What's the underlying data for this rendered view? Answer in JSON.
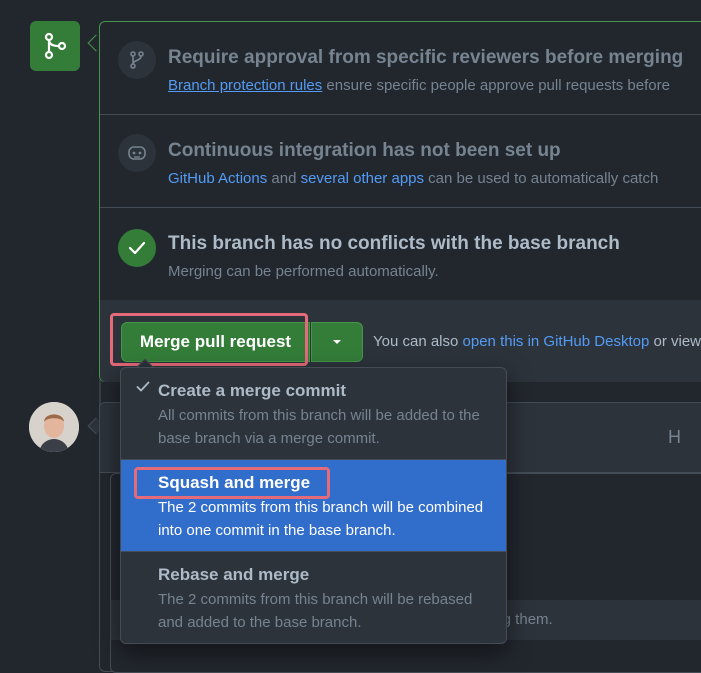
{
  "merge_box": {
    "reviewers": {
      "title": "Require approval from specific reviewers before merging",
      "link": "Branch protection rules",
      "rest": " ensure specific people approve pull requests before"
    },
    "ci": {
      "title": "Continuous integration has not been set up",
      "link1": "GitHub Actions",
      "mid": " and ",
      "link2": "several other apps",
      "rest": " can be used to automatically catch"
    },
    "conflicts": {
      "title": "This branch has no conflicts with the base branch",
      "desc": "Merging can be performed automatically."
    },
    "actions": {
      "merge_button": "Merge pull request",
      "also_prefix": "You can also ",
      "desktop_link": "open this in GitHub Desktop",
      "also_suffix": " or view"
    }
  },
  "comment": {
    "header_tool": "H",
    "footer_text": "ing them."
  },
  "merge_menu": {
    "items": [
      {
        "title": "Create a merge commit",
        "desc": "All commits from this branch will be added to the base branch via a merge commit.",
        "checked": true
      },
      {
        "title": "Squash and merge",
        "desc": "The 2 commits from this branch will be combined into one commit in the base branch.",
        "selected": true
      },
      {
        "title": "Rebase and merge",
        "desc": "The 2 commits from this branch will be rebased and added to the base branch."
      }
    ]
  },
  "colors": {
    "accent_green": "#347d39",
    "link_blue": "#539bf5",
    "selected_blue": "#316dca",
    "highlight_red": "#e56a7a"
  }
}
